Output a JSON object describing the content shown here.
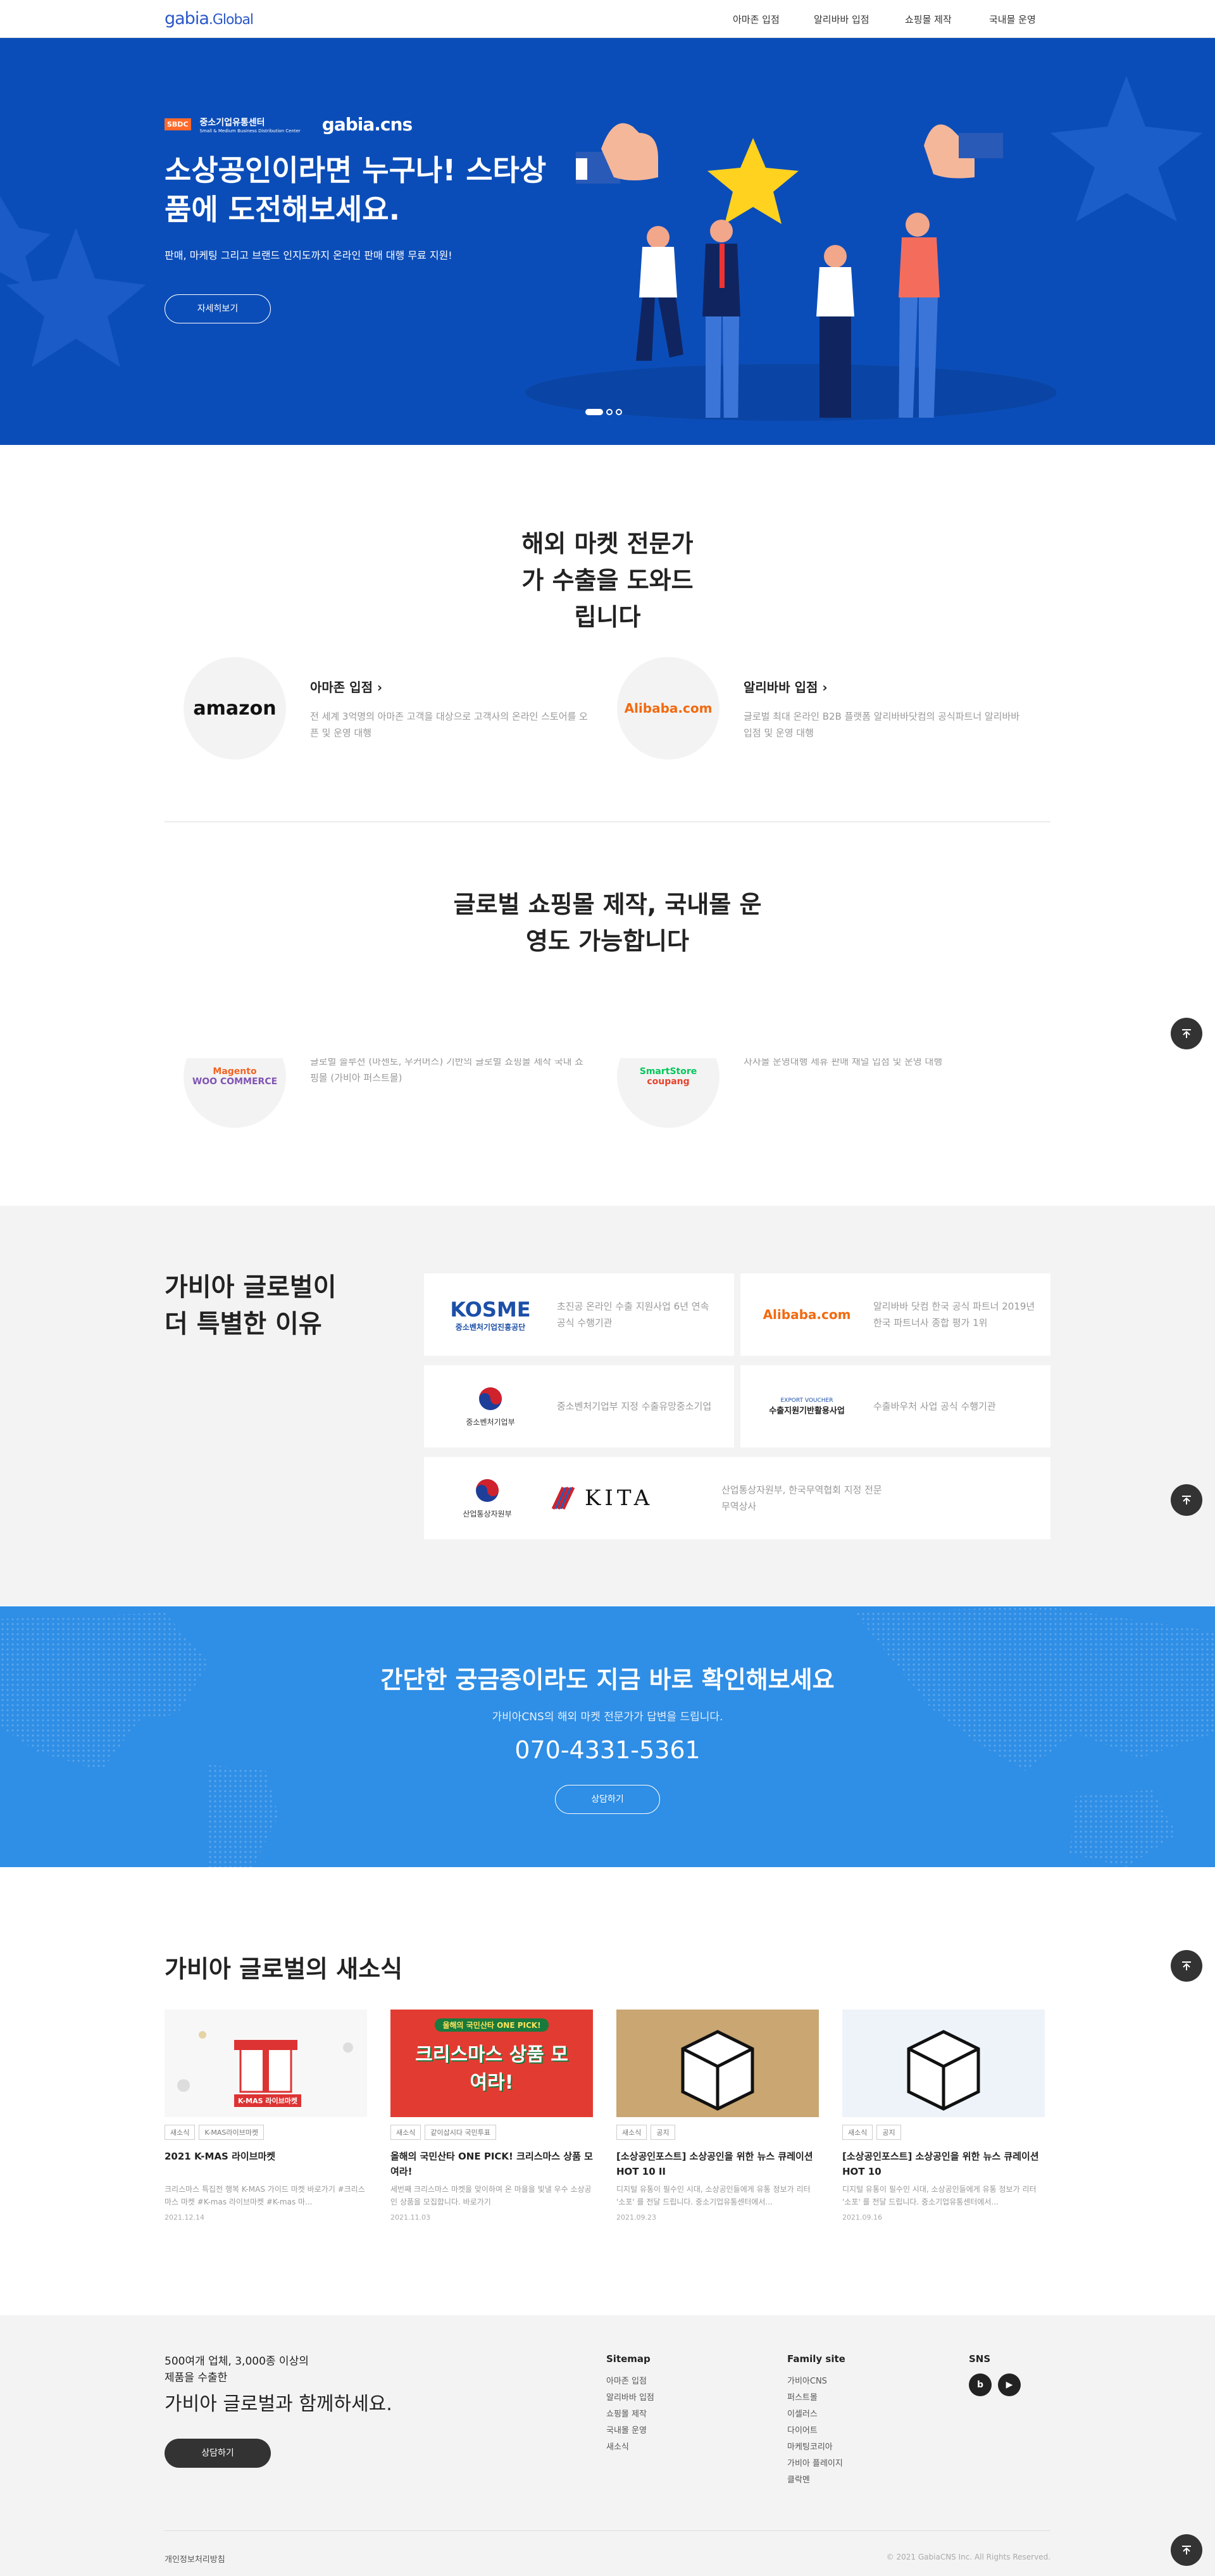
{
  "header": {
    "logo_main": "gabia",
    "logo_sub": ".Global",
    "nav": [
      "아마존 입점",
      "알리바바 입점",
      "쇼핑몰 제작",
      "국내몰 운영"
    ]
  },
  "hero": {
    "badge_org": "중소기업유통센터",
    "badge_org_en": "Small & Medium Business Distribution Center",
    "badge_sbdc": "SBDC",
    "badge_partner": "gabia.cns",
    "title": "소상공인이라면 누구나! 스타상품에 도전해보세요.",
    "subtitle": "판매, 마케팅 그리고 브랜드 인지도까지 온라인 판매 대행 무료 지원!",
    "button": "자세히보기"
  },
  "market": {
    "title": "해외 마켓 전문가가 수출을 도와드립니다",
    "items": [
      {
        "logo": "amazon",
        "title": "아마존 입점 ›",
        "desc": "전 세계 3억명의 아마존 고객을 대상으로 고객사의 온라인 스토어를 오픈 및 운영 대행"
      },
      {
        "logo": "Alibaba.com",
        "title": "알리바바 입점 ›",
        "desc": "글로벌 최대 온라인 B2B 플랫폼 알리바바닷컴의 공식파트너 알리바바 입점 및 운영 대행"
      }
    ]
  },
  "shop": {
    "title": "글로벌 쇼핑몰 제작, 국내몰 운영도 가능합니다",
    "items": [
      {
        "logo_a": "Magento",
        "logo_b": "WOO COMMERCE",
        "desc": "글로벌 솔루션 (마젠토, 우커머스) 기반의 글로벌 쇼핑몰 제작 국내 쇼핑몰 (가비아 퍼스트몰)"
      },
      {
        "logo_a": "SmartStore",
        "logo_b": "coupang",
        "desc": "자사몰 운영대행 제휴 판매 채널 입점 및 운영 대행"
      }
    ]
  },
  "why": {
    "title": "가비아 글로벌이 더 특별한 이유",
    "cards": [
      {
        "logo_a": "KOSME",
        "logo_b": "중소벤처기업진흥공단",
        "desc": "초진공 온라인 수출 지원사업 6년 연속 공식 수행기관"
      },
      {
        "logo_a": "Alibaba.com",
        "desc": "알리바바 닷컴 한국 공식 파트너 2019년 한국 파트너사 종합 평가 1위"
      },
      {
        "logo_a": "중소벤처기업부",
        "desc": "중소벤처기업부 지정 수출유망중소기업"
      },
      {
        "logo_a": "EXPORT VOUCHER",
        "logo_b": "수출지원기반활용사업",
        "desc": "수출바우처 사업 공식 수행기관"
      },
      {
        "logo_a": "산업통상자원부",
        "logo_b": "KITA",
        "desc": "산업통상자원부, 한국무역협회 지정 전문무역상사"
      }
    ]
  },
  "contact": {
    "title": "간단한 궁금증이라도 지금 바로 확인해보세요",
    "subtitle": "가비아CNS의 해외 마켓 전문가가 답변을 드립니다.",
    "phone": "070-4331-5361",
    "button": "상담하기"
  },
  "news": {
    "title": "가비아 글로벌의 새소식",
    "items": [
      {
        "tags": [
          "새소식",
          "K-MAS라이브마켓"
        ],
        "title": "2021 K-MAS 라이브마켓",
        "desc": "크리스마스 특집전 행복 K-MAS 가이드 마켓 바로가기 #크리스마스 마켓 #K-mas 라이브마켓 #K-mas 마...",
        "date": "2021.12.14",
        "thumb_text": "K-MAS 라이브마켓"
      },
      {
        "tags": [
          "새소식",
          "같이삽시다 국민투표"
        ],
        "title": "올해의 국민산타 ONE PICK! 크리스마스 상품 모여라!",
        "desc": "세번째 크리스마스 마켓을 맞이하여 온 마을을 빛낼 우수 소상공인 상품을 모집합니다. 바로가기",
        "date": "2021.11.03",
        "thumb_top": "올해의 국민산타 ONE PICK!",
        "thumb_text": "크리스마스 상품 모여라!"
      },
      {
        "tags": [
          "새소식",
          "공지"
        ],
        "title": "[소상공인포스트] 소상공인을 위한 뉴스 큐레이션 HOT 10 II",
        "desc": "디지털 유통이 필수인 시대, 소상공인들에게 유통 정보가 리터 '소포' 를 전달 드립니다. 중소기업유통센터에서...",
        "date": "2021.09.23",
        "thumb_text": "소포"
      },
      {
        "tags": [
          "새소식",
          "공지"
        ],
        "title": "[소상공인포스트] 소상공인을 위한 뉴스 큐레이션 HOT 10",
        "desc": "디지털 유통이 필수인 시대, 소상공인들에게 유통 정보가 리터 '소포' 를 전달 드립니다. 중소기업유통센터에서...",
        "date": "2021.09.16",
        "thumb_text": "소포"
      }
    ]
  },
  "footer": {
    "lead": "500여개 업체, 3,000종 이상의 제품을 수출한",
    "big": "가비아 글로벌과 함께하세요.",
    "button": "상담하기",
    "sitemap": {
      "title": "Sitemap",
      "items": [
        "아마존 입점",
        "알리바바 입점",
        "쇼핑몰 제작",
        "국내몰 운영",
        "새소식"
      ]
    },
    "family": {
      "title": "Family site",
      "items": [
        "가비아CNS",
        "퍼스트몰",
        "이셀러스",
        "다이어트",
        "마케팅코리아",
        "가비아 플레이지",
        "클락멘"
      ]
    },
    "sns": {
      "title": "SNS",
      "items": [
        "b",
        "▶"
      ]
    },
    "privacy": "개인정보처리방침",
    "copyright": "© 2021 GabiaCNS Inc. All Rights Reserved."
  },
  "colors": {
    "brand": "#0b4db8",
    "contact": "#2f8ee5",
    "gray_bg": "#f3f3f3"
  }
}
